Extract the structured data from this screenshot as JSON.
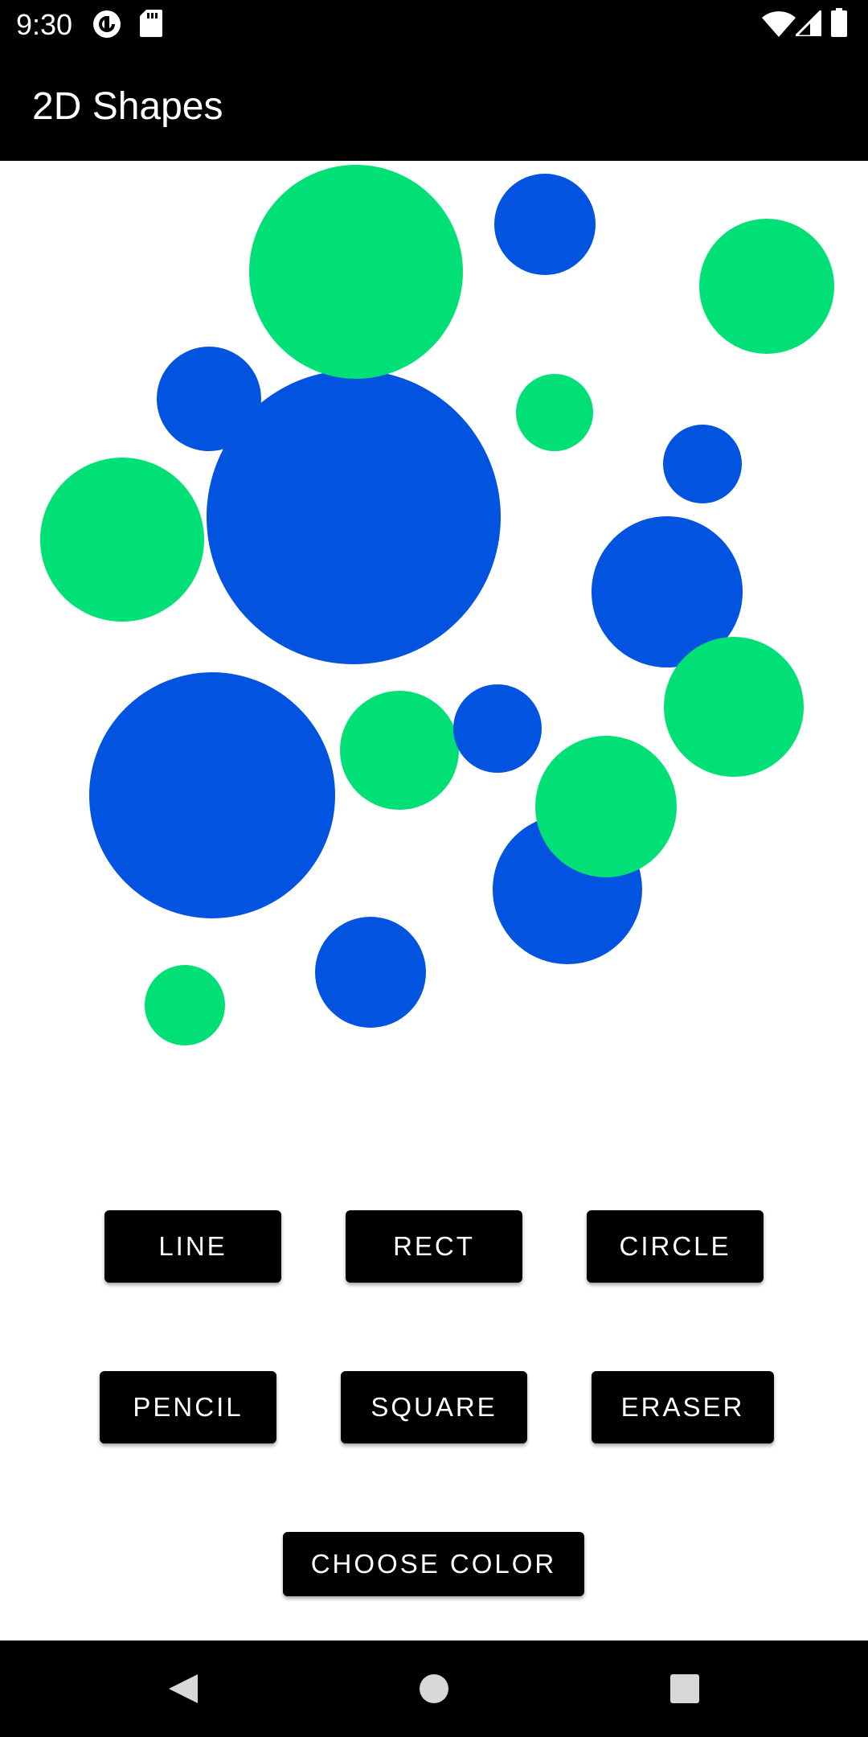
{
  "status_bar": {
    "time": "9:30",
    "left_icons": [
      "pocket-casts-icon",
      "sd-card-icon"
    ],
    "right_icons": [
      "wifi-icon",
      "cell-signal-icon",
      "battery-icon"
    ]
  },
  "app_bar": {
    "title": "2D Shapes"
  },
  "canvas": {
    "colors": {
      "blue": "#0254E0",
      "green": "#01E076"
    },
    "circles": [
      {
        "color": "blue"
      },
      {
        "color": "green"
      },
      {
        "color": "blue"
      },
      {
        "color": "green"
      },
      {
        "color": "blue"
      },
      {
        "color": "green"
      },
      {
        "color": "green"
      },
      {
        "color": "blue"
      },
      {
        "color": "blue"
      },
      {
        "color": "green"
      },
      {
        "color": "blue"
      },
      {
        "color": "green"
      },
      {
        "color": "blue"
      },
      {
        "color": "green"
      },
      {
        "color": "blue"
      },
      {
        "color": "green"
      },
      {
        "color": "blue"
      }
    ]
  },
  "tools": {
    "line": "LINE",
    "rect": "RECT",
    "circle": "CIRCLE",
    "pencil": "PENCIL",
    "square": "SQUARE",
    "eraser": "ERASER",
    "choose_color": "CHOOSE COLOR"
  },
  "nav_bar": {
    "icons": [
      "back-icon",
      "home-icon",
      "recents-icon"
    ]
  },
  "theme": {
    "bar_background": "#000000",
    "button_background": "#000000",
    "button_text": "#FFFFFF"
  }
}
